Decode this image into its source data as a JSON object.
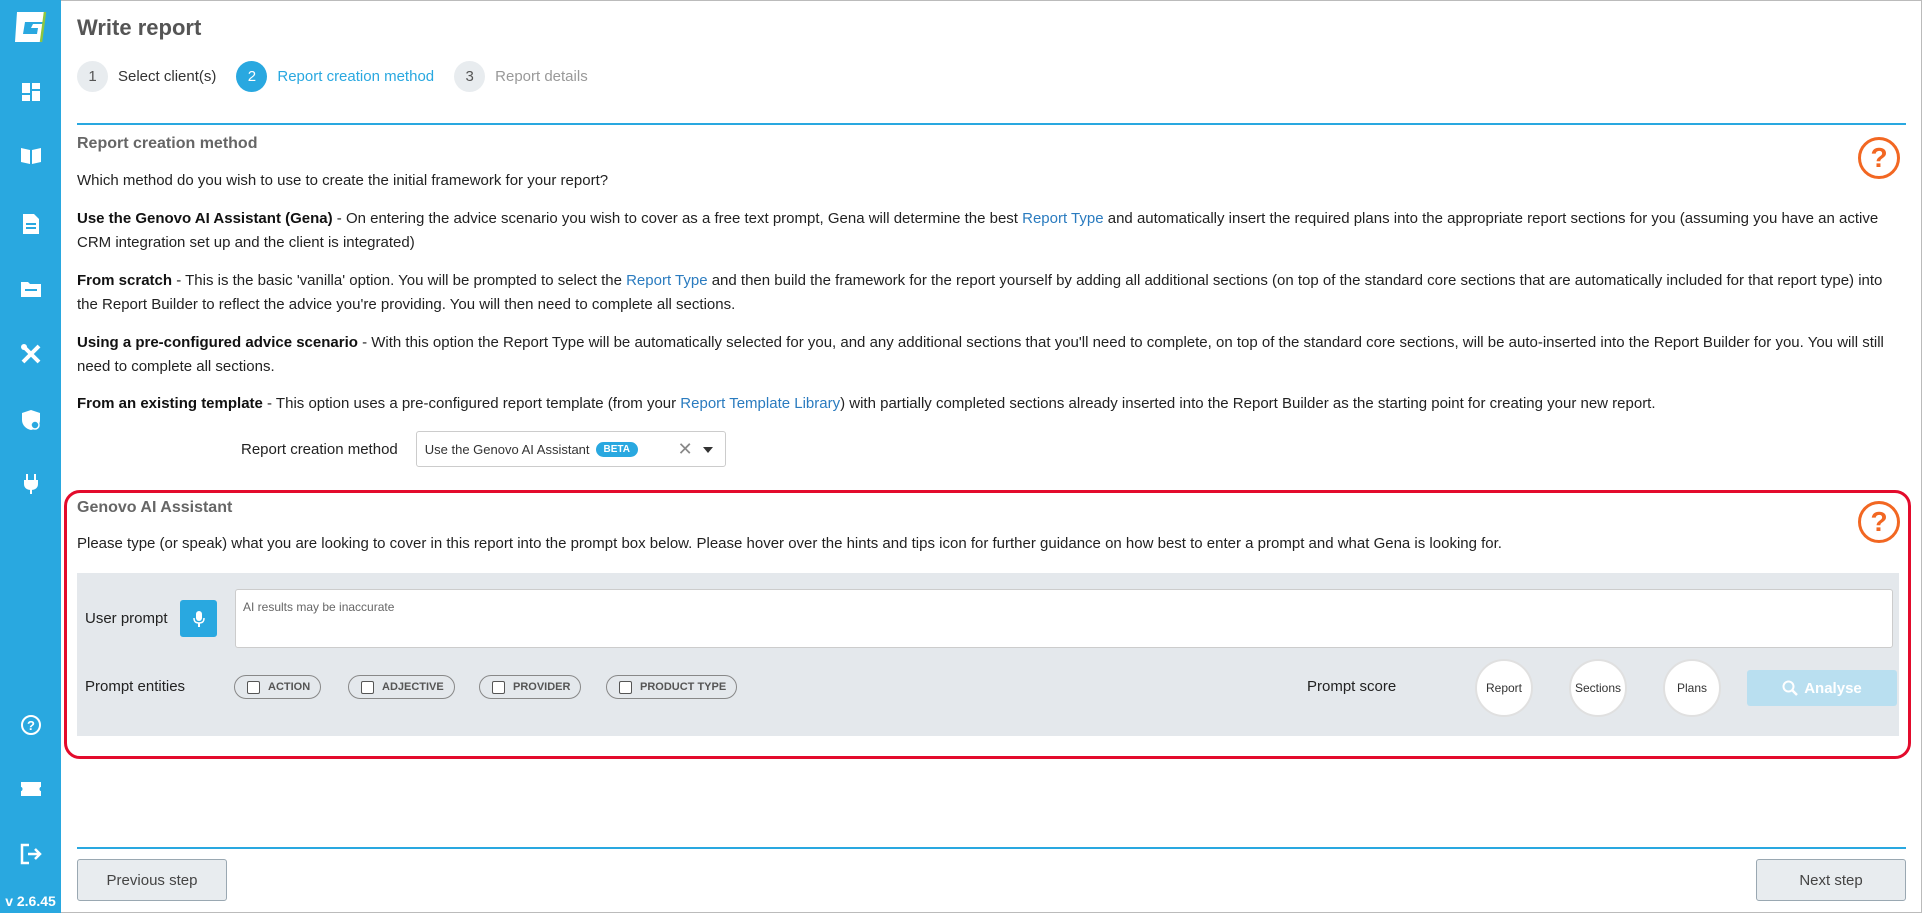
{
  "app": {
    "version": "v 2.6.45",
    "brand_color": "#29a8e0",
    "accent_color": "#f26722",
    "highlight_color": "#e30b2c"
  },
  "sidebar": {
    "items": [
      {
        "name": "dashboard-icon"
      },
      {
        "name": "book-icon"
      },
      {
        "name": "document-icon"
      },
      {
        "name": "folder-icon"
      },
      {
        "name": "tools-icon"
      },
      {
        "name": "shield-icon"
      },
      {
        "name": "plug-icon"
      },
      {
        "name": "help-circle-icon"
      },
      {
        "name": "ticket-icon"
      },
      {
        "name": "logout-icon"
      }
    ]
  },
  "header": {
    "title": "Write report"
  },
  "steps": [
    {
      "num": "1",
      "label": "Select client(s)",
      "state": "done"
    },
    {
      "num": "2",
      "label": "Report creation method",
      "state": "active"
    },
    {
      "num": "3",
      "label": "Report details",
      "state": "future"
    }
  ],
  "method_section": {
    "title": "Report creation method",
    "intro": "Which method do you wish to use to create the initial framework for your report?",
    "gena": {
      "title": "Use the Genovo AI Assistant (Gena)",
      "text_1": " - On entering the advice scenario you wish to cover as a free text prompt, Gena will determine the best ",
      "link": "Report Type",
      "text_2": " and automatically insert the required plans into the appropriate report sections for you (assuming you have an active CRM integration set up and the client is integrated)"
    },
    "scratch": {
      "title": "From scratch",
      "text_1": " - This is the basic 'vanilla' option. You will be prompted to select the ",
      "link": "Report Type",
      "text_2": " and then build the framework for the report yourself by adding all additional sections (on top of the standard core sections that are automatically included for that report type) into the Report Builder to reflect the advice you're providing. You will then need to complete all sections."
    },
    "preconfigured": {
      "title": "Using a pre-configured advice scenario",
      "text": " - With this option the Report Type will be automatically selected for you, and any additional sections that you'll need to complete, on top of the standard core sections, will be auto-inserted into the Report Builder for you. You will still need to complete all sections."
    },
    "template": {
      "title": "From an existing template",
      "text_1": " - This option uses a pre-configured report template (from your ",
      "link": "Report Template Library",
      "text_2": ") with partially completed sections already inserted into the Report Builder as the starting point for creating your new report."
    },
    "select_label": "Report creation method",
    "select_value": "Use the Genovo AI Assistant",
    "select_badge": "BETA",
    "clear_glyph": "✕"
  },
  "ai_section": {
    "title": "Genovo AI Assistant",
    "description": "Please type (or speak) what you are looking to cover in this report into the prompt box below. Please hover over the hints and tips icon for further guidance on how best to enter a prompt and what Gena is looking for.",
    "prompt_label": "User prompt",
    "prompt_placeholder": "AI results may be inaccurate",
    "prompt_value": "",
    "entities_label": "Prompt entities",
    "entities": [
      "ACTION",
      "ADJECTIVE",
      "PROVIDER",
      "PRODUCT TYPE"
    ],
    "score_label": "Prompt score",
    "scores": [
      "Report",
      "Sections",
      "Plans"
    ],
    "analyse_label": "Analyse"
  },
  "help_glyph": "?",
  "footer": {
    "previous_label": "Previous step",
    "next_label": "Next step"
  }
}
